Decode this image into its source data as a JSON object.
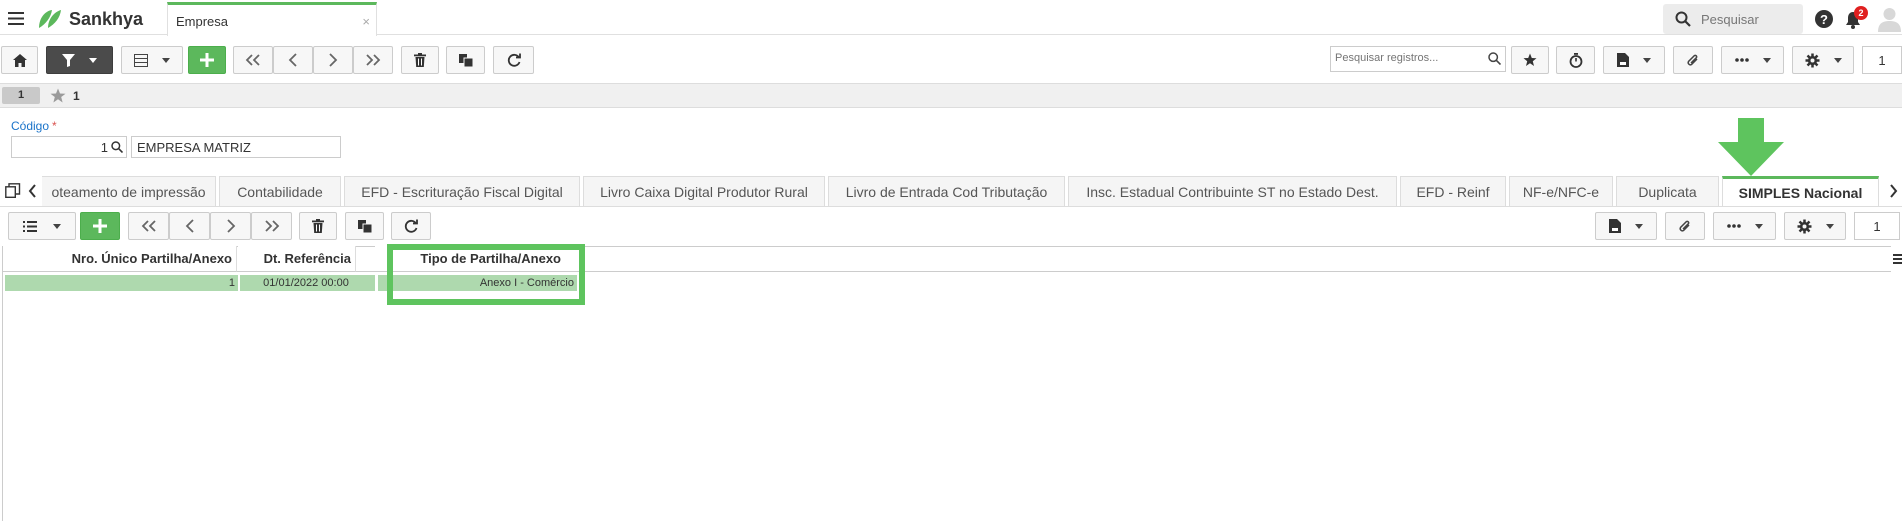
{
  "topbar": {
    "brand": "Sankhya",
    "tab_title": "Empresa",
    "tab_close": "×",
    "search_placeholder": "Pesquisar",
    "notification_count": "2"
  },
  "toolbar": {
    "search_records_placeholder": "Pesquisar registros...",
    "page_number": "1"
  },
  "crumb": {
    "pill": "1",
    "fav_count": "1"
  },
  "form": {
    "codigo_label": "Código",
    "required_mark": "*",
    "codigo_value": "1",
    "empresa_name": "EMPRESA MATRIZ"
  },
  "detail_tabs": [
    "oteamento de impressão",
    "Contabilidade",
    "EFD - Escrituração Fiscal Digital",
    "Livro Caixa Digital Produtor Rural",
    "Livro de Entrada Cod Tributação",
    "Insc. Estadual Contribuinte ST no Estado Dest.",
    "EFD - Reinf",
    "NF-e/NFC-e",
    "Duplicata",
    "SIMPLES Nacional"
  ],
  "grid": {
    "page_number": "1",
    "columns": [
      "Nro. Único Partilha/Anexo",
      "Dt. Referência",
      "Tipo de Partilha/Anexo"
    ],
    "rows": [
      [
        "1",
        "01/01/2022 00:00",
        "Anexo I - Comércio"
      ]
    ]
  },
  "colors": {
    "accent_green": "#5cb85c",
    "highlight_green": "#5ec45e",
    "link_blue": "#1a73c9",
    "row_selected": "#aed9ae"
  }
}
